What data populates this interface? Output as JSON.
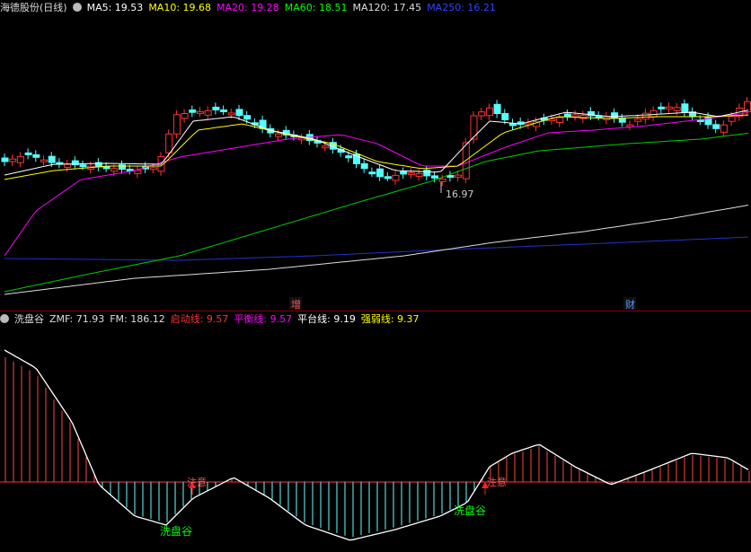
{
  "header": {
    "stock_name": "海德股份(日线)",
    "indicators": [
      {
        "label": "MA5: 19.53",
        "color": "#ffffff"
      },
      {
        "label": "MA10: 19.68",
        "color": "#ffff00"
      },
      {
        "label": "MA20: 19.28",
        "color": "#ff00ff"
      },
      {
        "label": "MA60: 18.51",
        "color": "#00ff00"
      },
      {
        "label": "MA120: 17.45",
        "color": "#dddddd"
      },
      {
        "label": "MA250: 16.21",
        "color": "#3344ff"
      }
    ]
  },
  "main_chart": {
    "low_marker": "16.97",
    "event_labels": [
      "增",
      "财"
    ]
  },
  "sub_header": {
    "name": "洗盘谷",
    "items": [
      {
        "label": "ZMF: 71.93",
        "color": "#dddddd"
      },
      {
        "label": "FM: 186.12",
        "color": "#dddddd"
      },
      {
        "label": "启动线: 9.57",
        "color": "#ff3333"
      },
      {
        "label": "平衡线: 9.57",
        "color": "#ff00ff"
      },
      {
        "label": "平台线: 9.19",
        "color": "#ffffff"
      },
      {
        "label": "强弱线: 9.37",
        "color": "#ffff00"
      }
    ]
  },
  "sub_chart": {
    "attention_label": "注意",
    "valley_label": "洗盘谷"
  },
  "colors": {
    "up": "#ff3333",
    "down": "#54ffff",
    "ma5": "#ffffff",
    "ma10": "#ffff00",
    "ma20": "#ff00ff",
    "ma60": "#00ff00",
    "ma120": "#dddddd",
    "ma250": "#2233cc"
  }
}
